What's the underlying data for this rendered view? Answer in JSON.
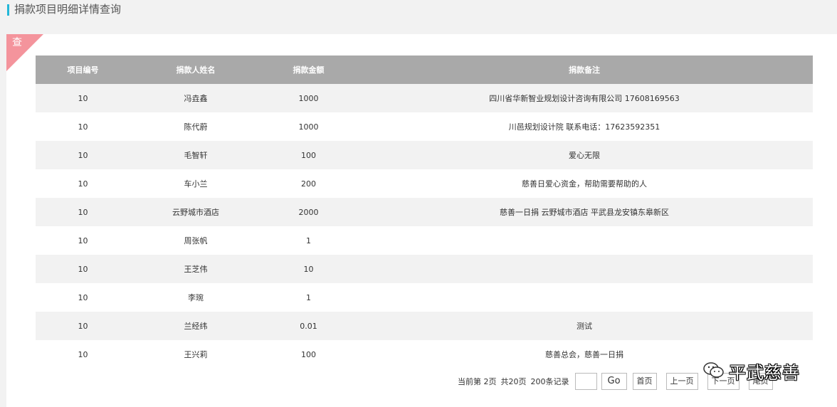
{
  "page": {
    "title": "捐款项目明细详情查询",
    "corner_label": "查"
  },
  "table": {
    "headers": [
      "项目编号",
      "捐款人姓名",
      "捐款金额",
      "捐款备注"
    ],
    "rows": [
      [
        "10",
        "冯垚鑫",
        "1000",
        "四川省华新智业规划设计咨询有限公司 17608169563"
      ],
      [
        "10",
        "陈代蔚",
        "1000",
        "川邑规划设计院 联系电话：17623592351"
      ],
      [
        "10",
        "毛智轩",
        "100",
        "爱心无限"
      ],
      [
        "10",
        "车小兰",
        "200",
        "慈善日爱心资金，帮助需要帮助的人"
      ],
      [
        "10",
        "云野城市酒店",
        "2000",
        "慈善一日捐 云野城市酒店 平武县龙安镇东皋新区"
      ],
      [
        "10",
        "周张帆",
        "1",
        ""
      ],
      [
        "10",
        "王芝伟",
        "10",
        ""
      ],
      [
        "10",
        "李琬",
        "1",
        ""
      ],
      [
        "10",
        "兰经纬",
        "0.01",
        "测试"
      ],
      [
        "10",
        "王兴莉",
        "100",
        "慈善总会，慈善一日捐"
      ]
    ]
  },
  "pager": {
    "current_page_text": "当前第 2页",
    "total_pages_text": "共20页",
    "total_records_text": "200条记录",
    "page_input_value": "",
    "go_label": "Go",
    "first_label": "首页",
    "prev_label": "上一页",
    "next_label": "下一页",
    "last_label": "尾页"
  },
  "watermark": {
    "text": "平武慈善",
    "icon": "wechat-icon"
  },
  "colors": {
    "accent": "#23b7d8",
    "corner": "#f4949c",
    "header_bg": "#a9a9a9",
    "stripe": "#f2f2f2"
  }
}
